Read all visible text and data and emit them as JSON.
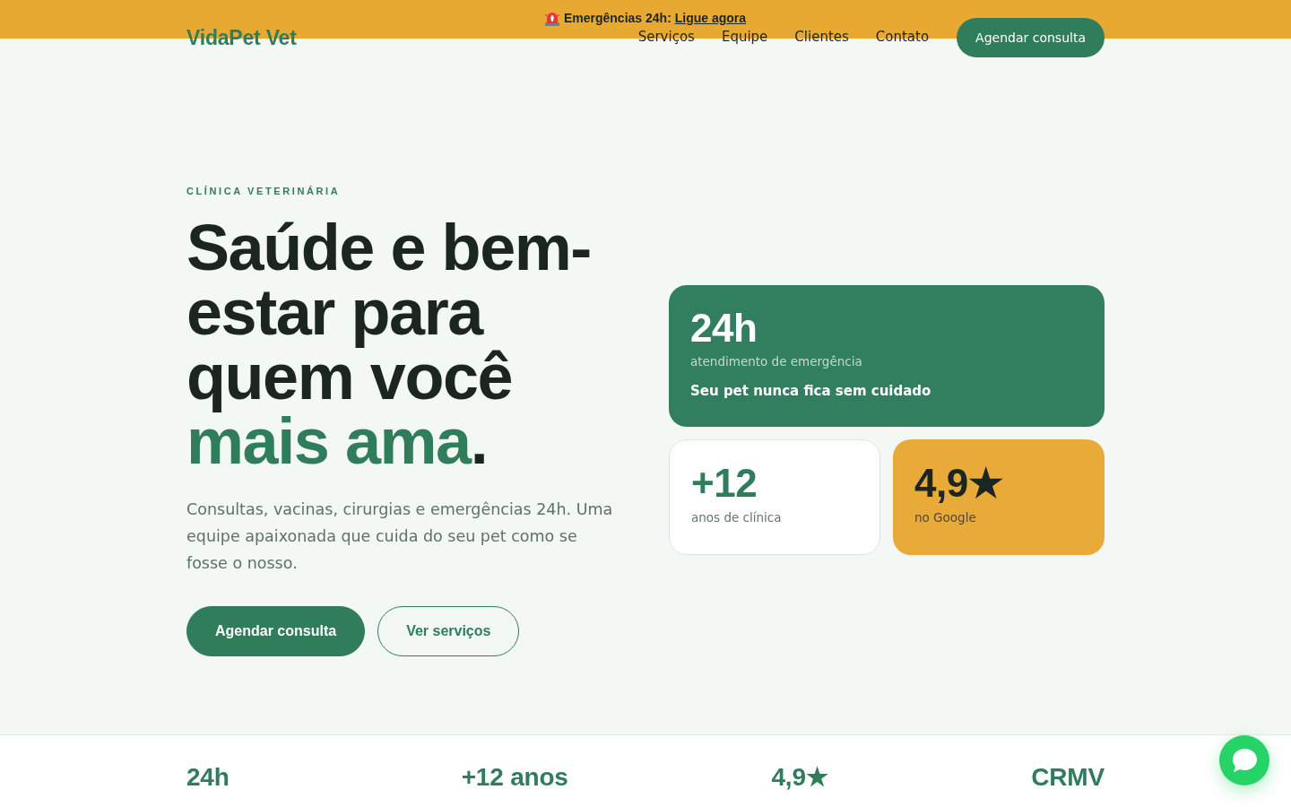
{
  "emergency_banner": {
    "text": "Emergências 24h:",
    "link": "Ligue agora"
  },
  "header": {
    "logo": "VidaPet Vet",
    "nav": [
      {
        "label": "Serviços"
      },
      {
        "label": "Equipe"
      },
      {
        "label": "Clientes"
      },
      {
        "label": "Contato"
      }
    ],
    "cta": "Agendar consulta"
  },
  "hero": {
    "eyebrow": "CLÍNICA VETERINÁRIA",
    "heading": {
      "text": "Saúde e bem-estar para quem você",
      "highlight": "mais ama",
      "end": "."
    },
    "description": "Consultas, vacinas, cirurgias e emergências 24h. Uma equipe apaixonada que cuida do seu pet como se fosse o nosso.",
    "buttons": [
      {
        "label": "Agendar consulta",
        "kind": "primary"
      },
      {
        "label": "Ver serviços",
        "kind": "outline"
      }
    ],
    "cards": [
      {
        "kind": "featured",
        "value": "24h",
        "label": "atendimento de emergência",
        "note": "Seu pet nunca fica sem cuidado"
      },
      {
        "kind": "plain",
        "value": "+12",
        "label": "anos de clínica"
      },
      {
        "kind": "accent",
        "value": "4,9★",
        "label": "no Google"
      }
    ]
  },
  "stats": [
    {
      "value": "24h"
    },
    {
      "value": "+12 anos"
    },
    {
      "value": "4,9★"
    },
    {
      "value": "CRMV"
    }
  ]
}
